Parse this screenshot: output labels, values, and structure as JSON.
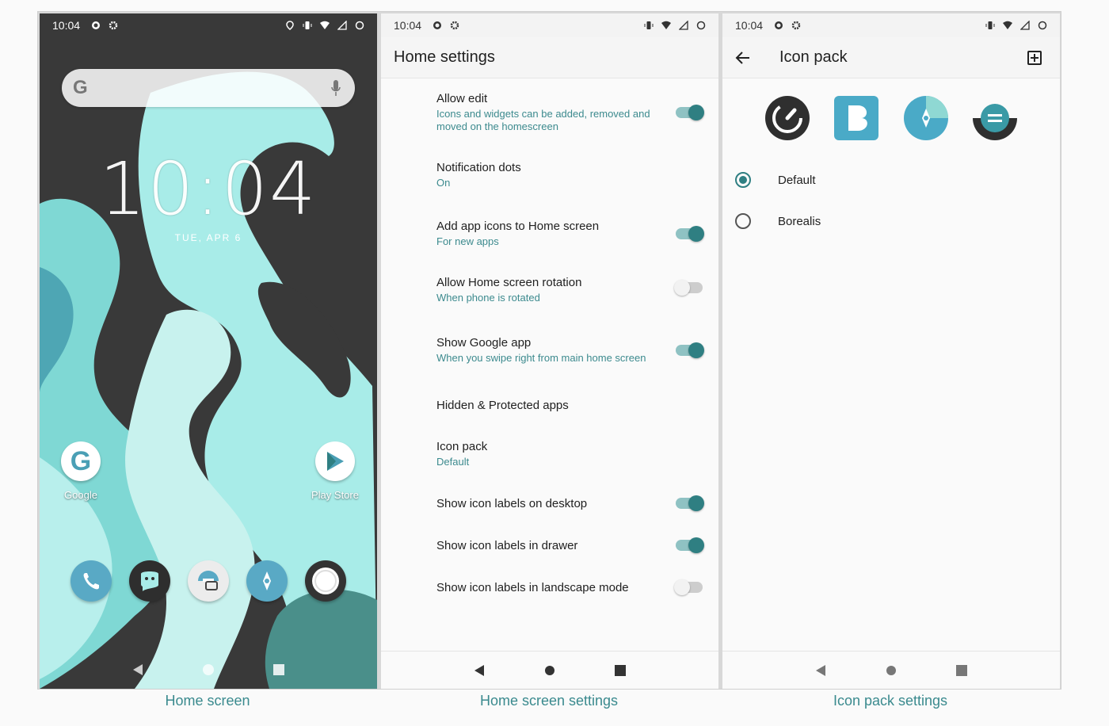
{
  "status": {
    "time": "10:04"
  },
  "home": {
    "clock": "10:04",
    "date": "TUE, APR 6",
    "apps": [
      {
        "label": "Google",
        "icon": "google-icon"
      },
      {
        "label": "Play Store",
        "icon": "play-store-icon"
      }
    ],
    "dock": [
      "phone-icon",
      "messaging-icon",
      "camera-icon",
      "maps-icon",
      "browser-icon"
    ]
  },
  "settings": {
    "title": "Home settings",
    "items": [
      {
        "title": "Allow edit",
        "summary": "Icons and widgets can be added, removed and moved on the homescreen",
        "switch": "on"
      },
      {
        "title": "Notification dots",
        "summary": "On",
        "switch": "none"
      },
      {
        "title": "Add app icons to Home screen",
        "summary": "For new apps",
        "switch": "on"
      },
      {
        "title": "Allow Home screen rotation",
        "summary": "When phone is rotated",
        "switch": "off"
      },
      {
        "title": "Show Google app",
        "summary": "When you swipe right from main home screen",
        "switch": "on"
      },
      {
        "title": "Hidden & Protected apps",
        "summary": "",
        "switch": "none"
      },
      {
        "title": "Icon pack",
        "summary": "Default",
        "switch": "none"
      },
      {
        "title": "Show icon labels on desktop",
        "summary": "",
        "switch": "on"
      },
      {
        "title": "Show icon labels in drawer",
        "summary": "",
        "switch": "on"
      },
      {
        "title": "Show icon labels in landscape mode",
        "summary": "",
        "switch": "off"
      }
    ]
  },
  "iconpack": {
    "title": "Icon pack",
    "options": [
      {
        "label": "Default",
        "checked": true
      },
      {
        "label": "Borealis",
        "checked": false
      }
    ]
  },
  "captions": [
    "Home screen",
    "Home screen settings",
    "Icon pack settings"
  ],
  "colors": {
    "accent": "#2f7f82",
    "summary": "#3c8a8e",
    "caption": "#3a8a8e"
  }
}
